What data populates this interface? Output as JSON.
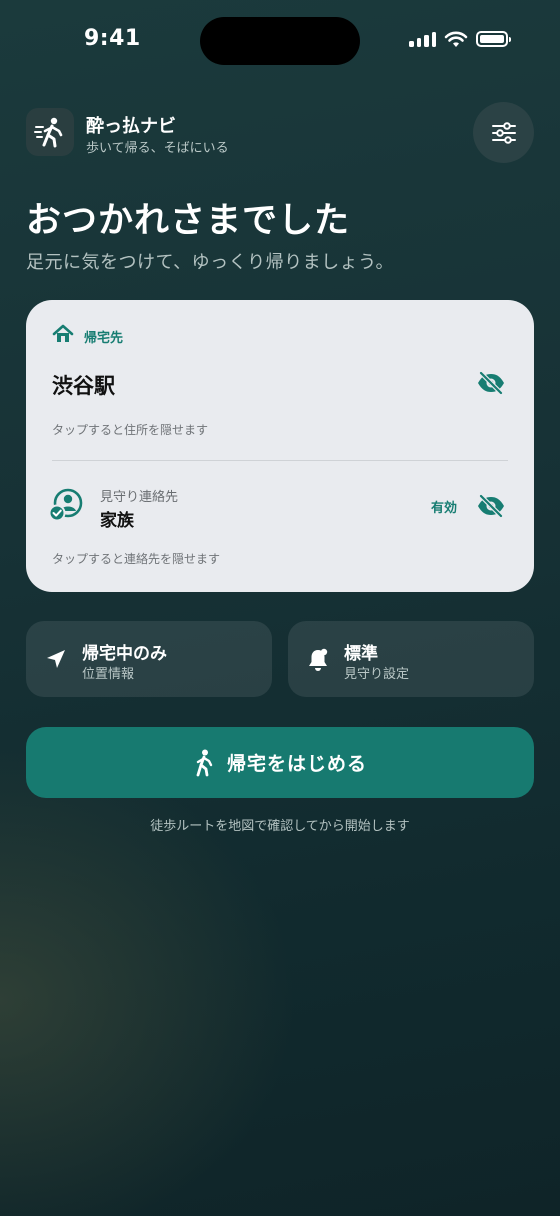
{
  "status_bar": {
    "time": "9:41",
    "icons": [
      "signal-icon",
      "wifi-icon",
      "battery-icon"
    ]
  },
  "header": {
    "app_icon": "walking-person-icon",
    "app_name": "酔っ払ナビ",
    "tagline": "歩いて帰る、そばにいる",
    "settings_icon": "sliders-icon"
  },
  "greeting": {
    "title": "おつかれさまでした",
    "subtitle": "足元に気をつけて、ゆっくり帰りましょう。"
  },
  "destination_card": {
    "home_label": "帰宅先",
    "destination": "渋谷駅",
    "destination_hint": "タップすると住所を隠せます",
    "contact_label": "見守り連絡先",
    "contact_name": "家族",
    "contact_status": "有効",
    "contact_hint": "タップすると連絡先を隠せます"
  },
  "options": {
    "location": {
      "title": "帰宅中のみ",
      "subtitle": "位置情報",
      "icon": "location-arrow-icon"
    },
    "watch": {
      "title": "標準",
      "subtitle": "見守り設定",
      "icon": "bell-icon"
    }
  },
  "start_button": {
    "label": "帰宅をはじめる",
    "icon": "walking-person-icon"
  },
  "footnote": "徒歩ルートを地図で確認してから開始します",
  "colors": {
    "accent": "#177a70",
    "accent_text": "#177d72",
    "card_bg": "#e9ebef",
    "background": "#163236"
  }
}
